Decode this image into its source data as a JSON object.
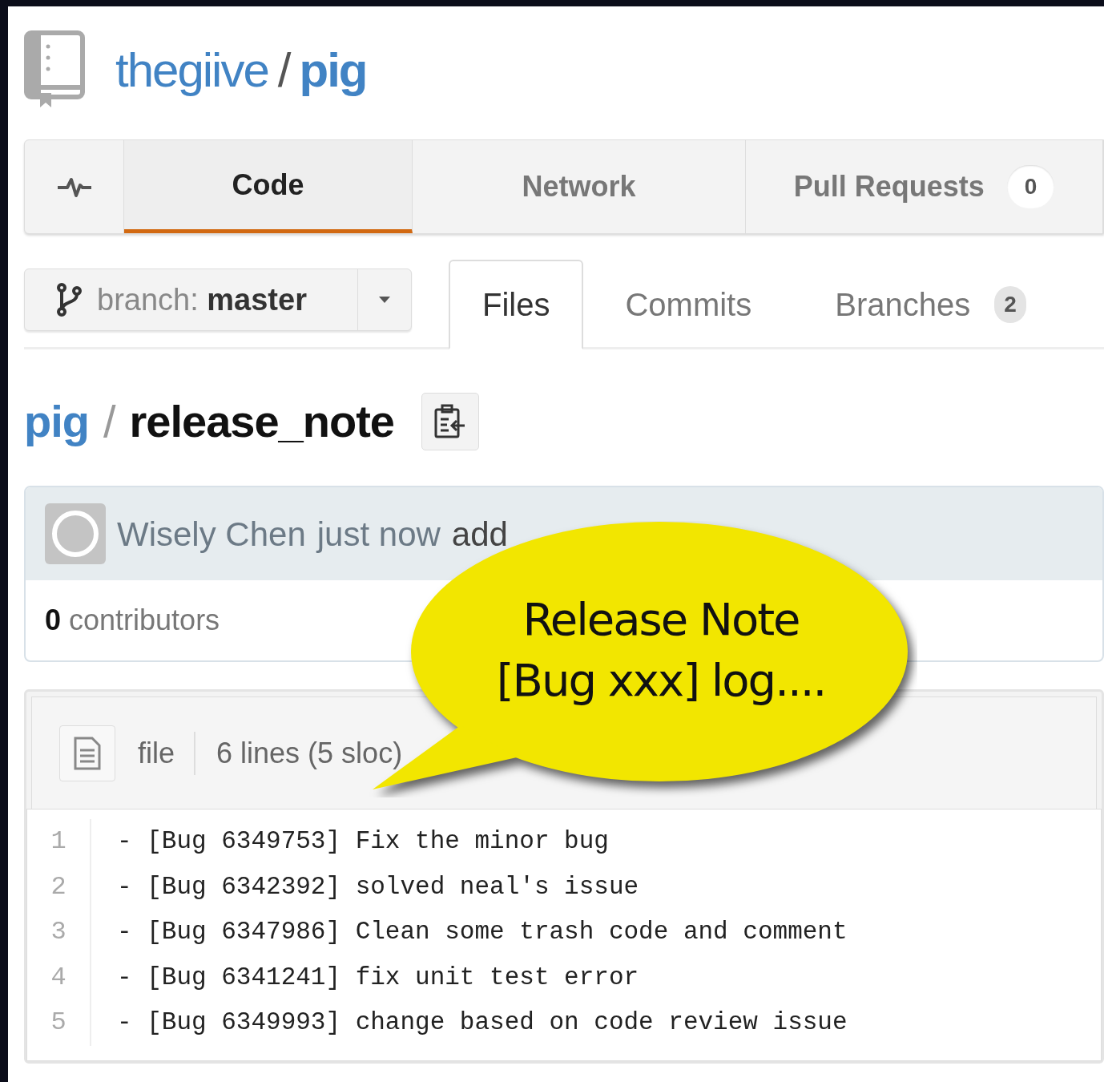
{
  "repo": {
    "owner": "thegiive",
    "separator": "/",
    "name": "pig"
  },
  "nav_tabs": [
    {
      "kind": "icon",
      "selected": false
    },
    {
      "kind": "text",
      "label": "Code",
      "selected": true
    },
    {
      "kind": "text",
      "label": "Network",
      "selected": false
    },
    {
      "kind": "text",
      "label": "Pull Requests",
      "count": "0",
      "selected": false
    }
  ],
  "branch_button": {
    "prefix": "branch:",
    "name": "master"
  },
  "sub_tabs": [
    {
      "label": "Files",
      "selected": true
    },
    {
      "label": "Commits",
      "selected": false
    },
    {
      "label": "Branches",
      "count": "2",
      "selected": false
    }
  ],
  "breadcrumb": {
    "repo": "pig",
    "separator": "/",
    "file": "release_note"
  },
  "commit": {
    "author": "Wisely Chen",
    "time": "just now",
    "message": "add"
  },
  "contributors": {
    "count": "0",
    "label": "contributors"
  },
  "file_header": {
    "mode": "file",
    "size": "6 lines (5 sloc)"
  },
  "code_lines": [
    {
      "number": "1",
      "text": "- [Bug 6349753] Fix the minor bug"
    },
    {
      "number": "2",
      "text": "- [Bug 6342392] solved neal's issue"
    },
    {
      "number": "3",
      "text": "- [Bug 6347986] Clean some trash code and comment"
    },
    {
      "number": "4",
      "text": "- [Bug 6341241] fix unit test error"
    },
    {
      "number": "5",
      "text": "- [Bug 6349993] change based on code review issue"
    }
  ],
  "callout": {
    "lines": [
      "Release Note",
      "[Bug xxx] log...."
    ]
  }
}
